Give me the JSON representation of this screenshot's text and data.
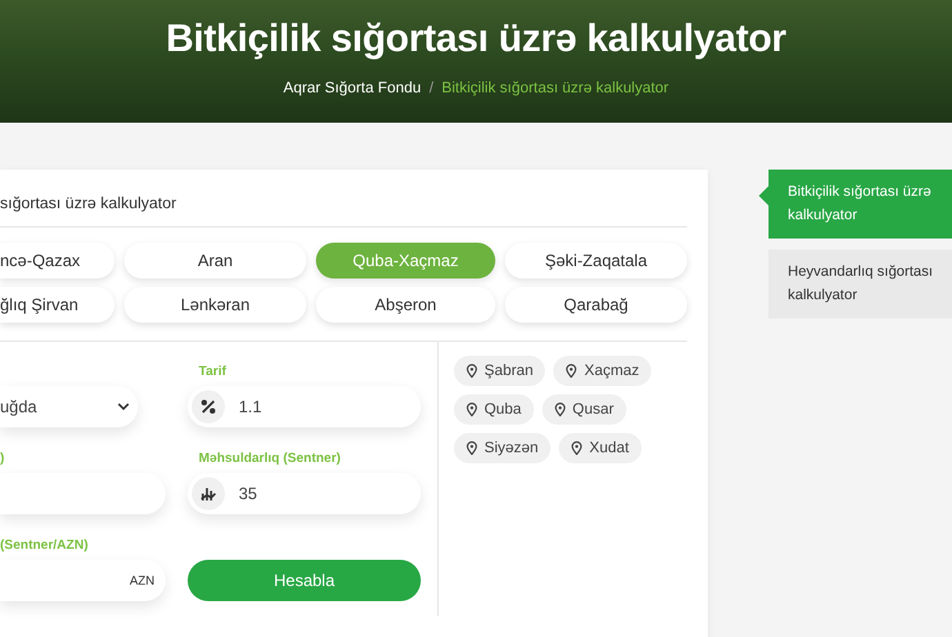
{
  "header": {
    "title": "Bitkiçilik sığortası üzrə kalkulyator",
    "breadcrumb": [
      {
        "label": "Aqrar Sığorta Fondu",
        "selected": false
      },
      {
        "label": "Bitkiçilik sığortası üzrə kalkulyator",
        "selected": true
      }
    ],
    "separator": "/"
  },
  "calculator": {
    "title": "sığortası üzrə kalkulyator",
    "regions": [
      {
        "label": "ncə-Qazax",
        "selected": false
      },
      {
        "label": "Aran",
        "selected": false
      },
      {
        "label": "Quba-Xaçmaz",
        "selected": true
      },
      {
        "label": "Şəki-Zaqatala",
        "selected": false
      },
      {
        "label": "ğlıq Şirvan",
        "selected": false
      },
      {
        "label": "Lənkəran",
        "selected": false
      },
      {
        "label": "Abşeron",
        "selected": false
      },
      {
        "label": "Qarabağ",
        "selected": false
      }
    ],
    "fields": [
      {
        "kind": "select",
        "value": "uğda"
      },
      {
        "kind": "rate",
        "label": "Tarif",
        "value": "1.1"
      },
      {
        "kind": "input",
        "label": ")"
      },
      {
        "kind": "yield",
        "label": "Məhsuldarlıq (Sentner)",
        "value": "35"
      },
      {
        "kind": "input",
        "label": "(Sentner/AZN)",
        "suffix": "AZN"
      },
      {
        "kind": "button",
        "label": "Hesabla"
      }
    ],
    "districts": [
      "Şabran",
      "Xaçmaz",
      "Quba",
      "Qusar",
      "Siyəzən",
      "Xudat"
    ]
  },
  "sidebar": {
    "items": [
      {
        "label": "Bitkiçilik sığortası üzrə kalkulyator",
        "selected": true
      },
      {
        "label": "Heyvandarlıq sığortası kalkulyator",
        "selected": false
      }
    ]
  }
}
